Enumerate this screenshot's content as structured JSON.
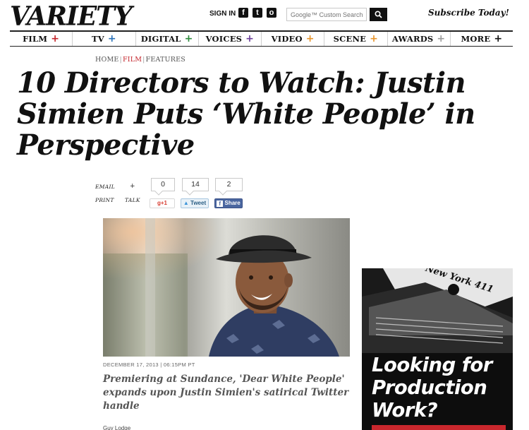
{
  "masthead": {
    "logo": "VARIETY",
    "sign_in": "SIGN IN",
    "social": [
      {
        "icon": "facebook-icon",
        "glyph": "f"
      },
      {
        "icon": "twitter-icon",
        "glyph": "t"
      },
      {
        "icon": "instagram-icon",
        "glyph": "o"
      }
    ],
    "search_placeholder": "Google™ Custom Search",
    "subscribe": "Subscribe Today!"
  },
  "nav": [
    {
      "label": "FILM",
      "plus_color": "#c4252c"
    },
    {
      "label": "TV",
      "plus_color": "#2a72b8"
    },
    {
      "label": "DIGITAL",
      "plus_color": "#2e8b3d"
    },
    {
      "label": "VOICES",
      "plus_color": "#6b3e99"
    },
    {
      "label": "VIDEO",
      "plus_color": "#e8952c"
    },
    {
      "label": "SCENE",
      "plus_color": "#e8952c"
    },
    {
      "label": "AWARDS",
      "plus_color": "#9a9a9a"
    },
    {
      "label": "MORE",
      "plus_color": "#111111"
    }
  ],
  "breadcrumb": {
    "home": "HOME",
    "section": "FILM",
    "subsection": "FEATURES"
  },
  "article": {
    "headline": "10 Directors to Watch: Justin Simien Puts ‘White People’ in Perspective",
    "dateline": "DECEMBER 17, 2013 | 06:15PM PT",
    "dek": "Premiering at Sundance, 'Dear White People' expands upon Justin Simien's satirical Twitter handle",
    "byline_stub": "Guy Lodge"
  },
  "share": {
    "email": "EMAIL",
    "print": "PRINT",
    "plus": "+",
    "talk": "TALK",
    "gplus_count": "0",
    "gplus_label": "g+1",
    "tweet_count": "14",
    "tweet_label": "Tweet",
    "fb_count": "2",
    "fb_label": "Share"
  },
  "ad": {
    "headline": "Looking for Production Work?",
    "sign_text": "New York 411"
  }
}
